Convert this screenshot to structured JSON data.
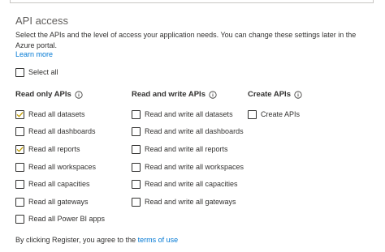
{
  "section": {
    "title": "API access",
    "description": "Select the APIs and the level of access your application needs. You can change these settings later in the Azure portal.",
    "learn_more": "Learn more"
  },
  "select_all": {
    "label": "Select all",
    "checked": false
  },
  "columns": [
    {
      "header": "Read only APIs",
      "items": [
        {
          "label": "Read all datasets",
          "checked": true
        },
        {
          "label": "Read all dashboards",
          "checked": false
        },
        {
          "label": "Read all reports",
          "checked": true
        },
        {
          "label": "Read all workspaces",
          "checked": false
        },
        {
          "label": "Read all capacities",
          "checked": false
        },
        {
          "label": "Read all gateways",
          "checked": false
        },
        {
          "label": "Read all Power BI apps",
          "checked": false
        }
      ]
    },
    {
      "header": "Read and write APIs",
      "items": [
        {
          "label": "Read and write all datasets",
          "checked": false
        },
        {
          "label": "Read and write all dashboards",
          "checked": false
        },
        {
          "label": "Read and write all reports",
          "checked": false
        },
        {
          "label": "Read and write all workspaces",
          "checked": false
        },
        {
          "label": "Read and write all capacities",
          "checked": false
        },
        {
          "label": "Read and write all gateways",
          "checked": false
        }
      ]
    },
    {
      "header": "Create APIs",
      "items": [
        {
          "label": "Create APIs",
          "checked": false
        }
      ]
    }
  ],
  "footer": {
    "prefix": "By clicking Register, you agree to the ",
    "link": "terms of use"
  },
  "colors": {
    "check": "#c19c00",
    "link": "#0078d4",
    "text": "#323130"
  },
  "icons": {
    "info": "info-icon",
    "check": "checkmark-icon"
  }
}
